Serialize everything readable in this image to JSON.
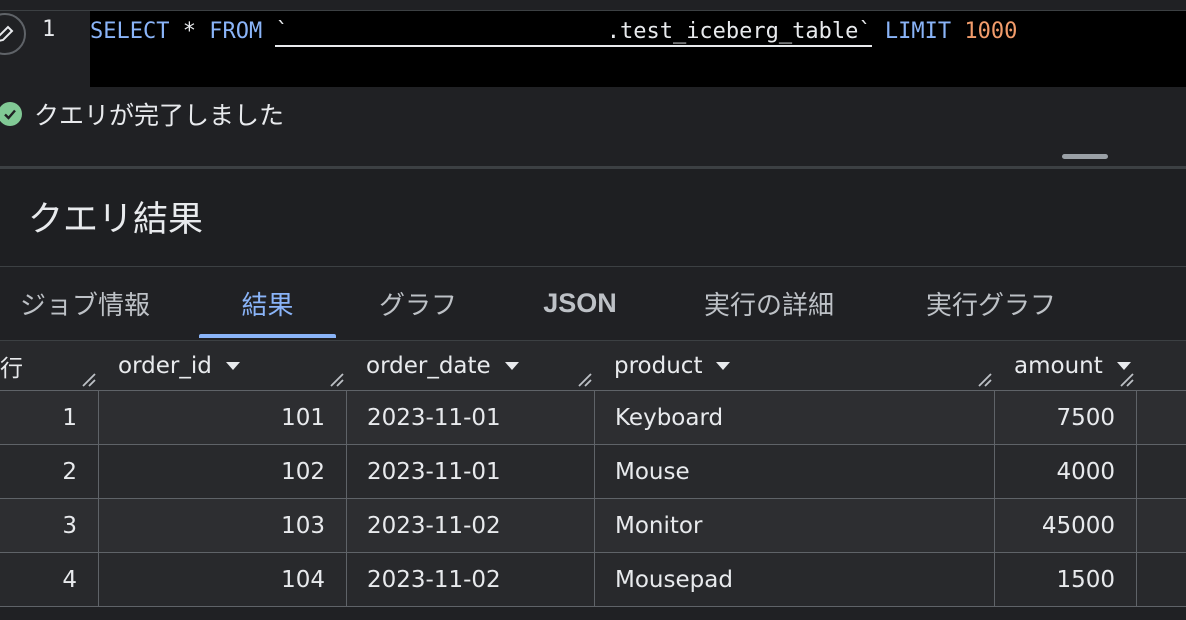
{
  "editor": {
    "line_number": "1",
    "code": {
      "select": "SELECT",
      "star": "*",
      "from": "FROM",
      "backtick_open": "`",
      "table": ".test_iceberg_table`",
      "limit": "LIMIT",
      "limit_value": "1000"
    }
  },
  "status": {
    "message": "クエリが完了しました",
    "icon": "check-circle-icon",
    "color": "#81c995"
  },
  "results": {
    "title": "クエリ結果",
    "tabs": [
      {
        "label": "ジョブ情報"
      },
      {
        "label": "結果"
      },
      {
        "label": "グラフ"
      },
      {
        "label": "JSON"
      },
      {
        "label": "実行の詳細"
      },
      {
        "label": "実行グラフ"
      }
    ],
    "active_tab": "結果",
    "accent": "#8ab4f8"
  },
  "table": {
    "columns": [
      "行",
      "order_id",
      "order_date",
      "product",
      "amount"
    ],
    "rows": [
      [
        "1",
        "101",
        "2023-11-01",
        "Keyboard",
        "7500"
      ],
      [
        "2",
        "102",
        "2023-11-01",
        "Mouse",
        "4000"
      ],
      [
        "3",
        "103",
        "2023-11-02",
        "Monitor",
        "45000"
      ],
      [
        "4",
        "104",
        "2023-11-02",
        "Mousepad",
        "1500"
      ]
    ]
  }
}
